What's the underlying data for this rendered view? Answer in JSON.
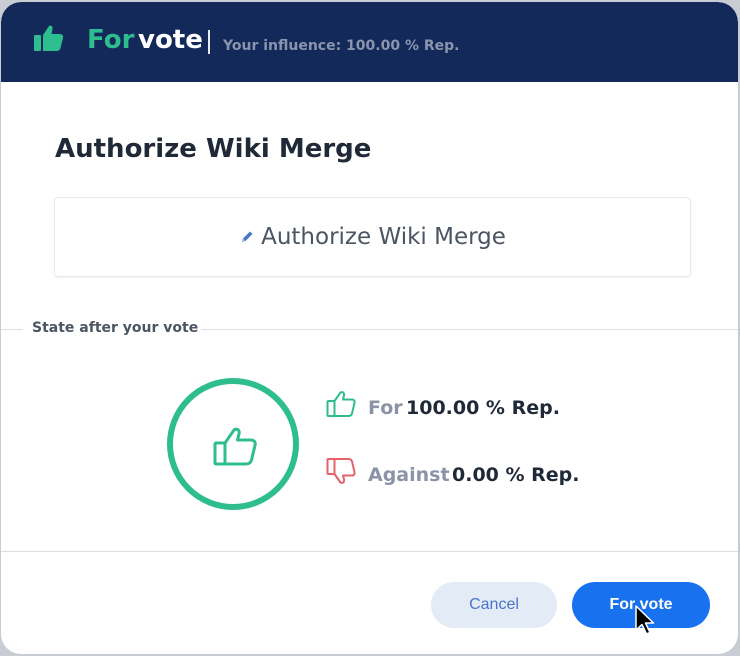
{
  "header": {
    "icon": "thumbs-up-icon",
    "for_label": "For",
    "vote_label": "vote",
    "separator": "|",
    "influence_text": "Your influence: 100.00 % Rep."
  },
  "dialog": {
    "title": "Authorize Wiki Merge",
    "action_icon": "pencil-icon",
    "action_label": "Authorize Wiki Merge",
    "state_label": "State after your vote"
  },
  "vote_state": {
    "ring_icon": "thumbs-up-icon",
    "for_label": "For",
    "for_value": "100.00 % Rep.",
    "against_label": "Against",
    "against_value": "0.00 % Rep."
  },
  "buttons": {
    "cancel_label": "Cancel",
    "primary_label": "For vote"
  },
  "colors": {
    "header_bg": "#13295a",
    "accent_green": "#2ebd8e",
    "against_red": "#e4626b",
    "primary_blue": "#1872f0"
  }
}
